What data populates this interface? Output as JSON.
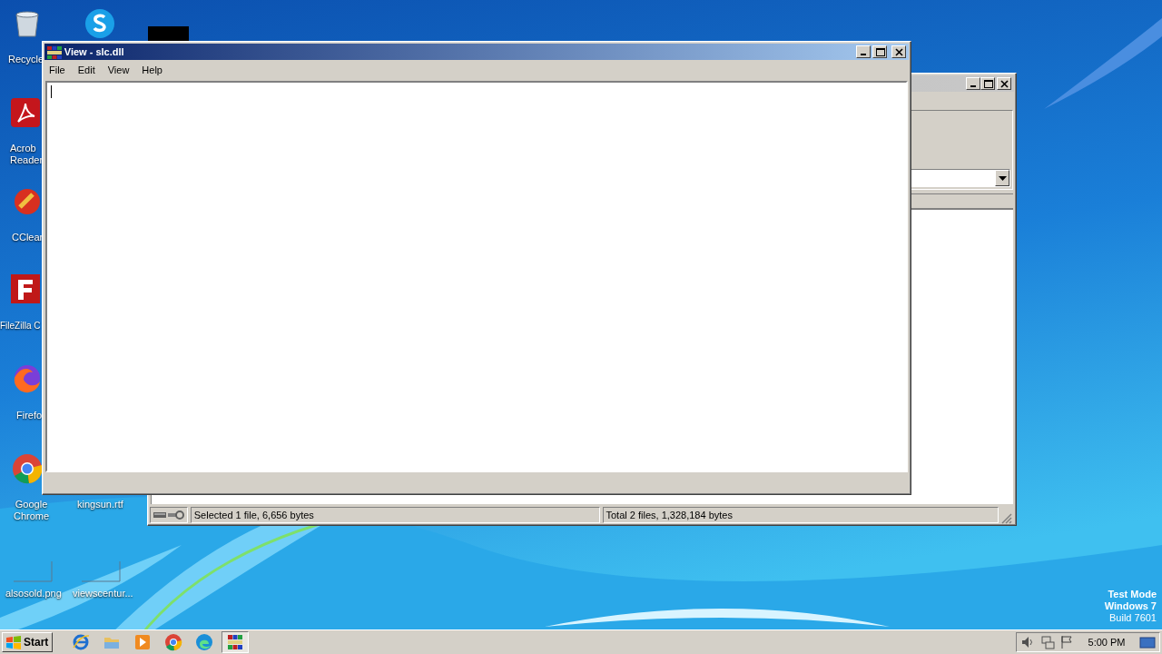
{
  "desktop": {
    "icons": [
      {
        "kind": "recycle-bin",
        "lines": [
          "Recycle"
        ]
      },
      {
        "kind": "chat-app"
      },
      {
        "kind": "pdf-reader",
        "lines": [
          "Acrob",
          "Reader"
        ]
      },
      {
        "kind": "cleaner",
        "lines": [
          "CClear"
        ]
      },
      {
        "kind": "ftp-client",
        "lines": [
          "FileZilla C"
        ]
      },
      {
        "kind": "fox-browser",
        "lines": [
          "Firefo"
        ]
      },
      {
        "kind": "chrome-browser",
        "lines": [
          "Google",
          "Chrome"
        ]
      },
      {
        "kind": "hidden",
        "lines": [
          "kingsun.rtf"
        ]
      },
      {
        "kind": "thumbnail",
        "lines": [
          "alsosold.png"
        ]
      },
      {
        "kind": "thumbnail",
        "lines": [
          "viewscentur..."
        ]
      }
    ],
    "system_text": [
      "Test Mode",
      "Windows 7",
      "Build 7601"
    ]
  },
  "back_window": {
    "status_bar": [
      "Selected 1 file, 6,656 bytes",
      "Total 2 files, 1,328,184 bytes"
    ]
  },
  "viewer_window": {
    "title": "View - slc.dll",
    "menu": [
      "File",
      "Edit",
      "View",
      "Help"
    ]
  },
  "taskbar": {
    "start": "Start",
    "apps": [
      {
        "kind": "ie",
        "selected": false
      },
      {
        "kind": "folder",
        "selected": false
      },
      {
        "kind": "media",
        "selected": false
      },
      {
        "kind": "chrome",
        "selected": false
      },
      {
        "kind": "edge",
        "selected": false
      },
      {
        "kind": "archiver",
        "selected": true
      }
    ],
    "time": "5:00 PM"
  }
}
